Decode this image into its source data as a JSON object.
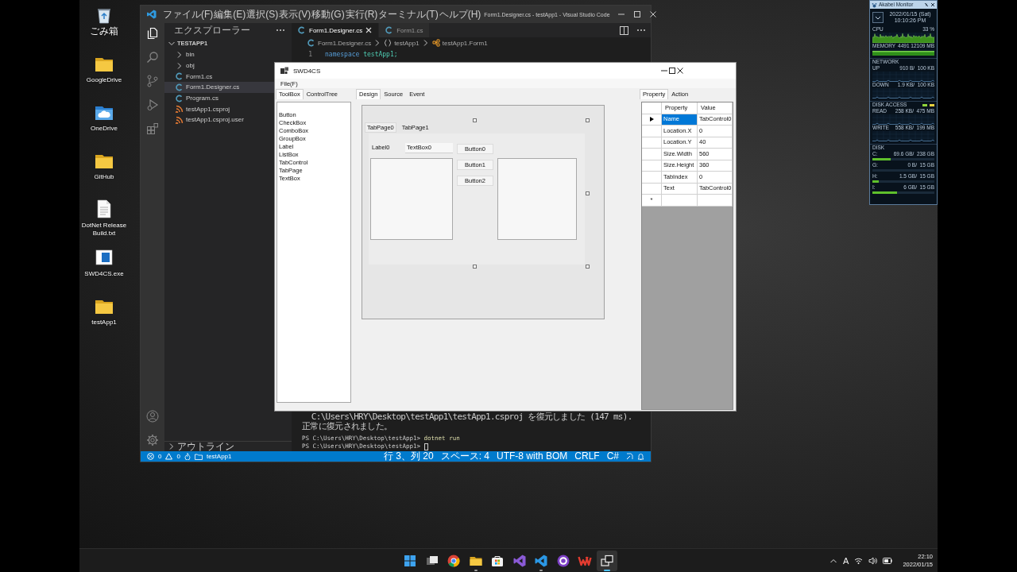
{
  "desktop_icons": [
    {
      "label": "ごみ箱",
      "kind": "recycle"
    },
    {
      "label": "GoogleDrive",
      "kind": "folder"
    },
    {
      "label": "OneDrive",
      "kind": "cloud"
    },
    {
      "label": "GitHub",
      "kind": "folder"
    },
    {
      "label": "DotNet Release Build.txt",
      "kind": "text"
    },
    {
      "label": "SWD4CS.exe",
      "kind": "app"
    },
    {
      "label": "testApp1",
      "kind": "folder"
    }
  ],
  "vscode": {
    "menu": [
      "ファイル(F)",
      "編集(E)",
      "選択(S)",
      "表示(V)",
      "移動(G)",
      "実行(R)",
      "ターミナル(T)",
      "ヘルプ(H)"
    ],
    "title": "Form1.Designer.cs - testApp1 - Visual Studio Code",
    "activity_bar": [
      {
        "kind": "explorer",
        "selected": true
      },
      {
        "kind": "search",
        "selected": false
      },
      {
        "kind": "source_control",
        "selected": false
      },
      {
        "kind": "run",
        "selected": false
      },
      {
        "kind": "extensions",
        "selected": false
      },
      {
        "kind": "account",
        "selected": false
      },
      {
        "kind": "settings",
        "selected": false
      }
    ],
    "explorer": {
      "title": "エクスプローラー",
      "project": "TESTAPP1",
      "items": [
        {
          "label": "bin",
          "kind": "folder",
          "expanded": false,
          "selected": false
        },
        {
          "label": "obj",
          "kind": "folder",
          "expanded": false,
          "selected": false
        },
        {
          "label": "Form1.cs",
          "kind": "csharp",
          "selected": false
        },
        {
          "label": "Form1.Designer.cs",
          "kind": "csharp",
          "selected": true
        },
        {
          "label": "Program.cs",
          "kind": "csharp",
          "selected": false
        },
        {
          "label": "testApp1.csproj",
          "kind": "project",
          "selected": false
        },
        {
          "label": "testApp1.csproj.user",
          "kind": "project",
          "selected": false
        }
      ],
      "outline": "アウトライン"
    },
    "tabs": [
      {
        "label": "Form1.Designer.cs",
        "selected": true
      },
      {
        "label": "Form1.cs",
        "selected": false
      }
    ],
    "breadcrumb": [
      {
        "label": "Form1.Designer.cs",
        "kind": "file"
      },
      {
        "label": "testApp1",
        "kind": "namespace"
      },
      {
        "label": "testApp1.Form1",
        "kind": "class"
      }
    ],
    "code_lines": [
      {
        "number": "1",
        "keyword": "namespace",
        "text": " testApp1;"
      }
    ],
    "terminal_lines": [
      {
        "kind": "output",
        "text": "  C:\\Users\\HRY\\Desktop\\testApp1\\testApp1.csproj を復元しました (147 ms)."
      },
      {
        "kind": "output",
        "text": "正常に復元されました。"
      },
      {
        "kind": "prompt",
        "prompt": "PS C:\\Users\\HRY\\Desktop\\testApp1> ",
        "command": "dotnet run"
      },
      {
        "kind": "prompt",
        "prompt": "PS C:\\Users\\HRY\\Desktop\\testApp1> ",
        "cursor": true
      }
    ],
    "status_bar": {
      "errors": "0",
      "warnings": "0",
      "folder": "testApp1",
      "items": [
        "行 3、列 20",
        "スペース: 4",
        "UTF-8 with BOM",
        "CRLF",
        "C#"
      ]
    }
  },
  "swd4cs": {
    "title": "SWD4CS",
    "menu": [
      "File(F)"
    ],
    "left_tabs": [
      {
        "label": "ToolBox",
        "selected": true
      },
      {
        "label": "ControlTree",
        "selected": false
      }
    ],
    "toolbox_items": [
      "Button",
      "CheckBox",
      "ComboBox",
      "GroupBox",
      "Label",
      "ListBox",
      "TabControl",
      "TabPage",
      "TextBox"
    ],
    "center_tabs": [
      {
        "label": "Design",
        "selected": true
      },
      {
        "label": "Source",
        "selected": false
      },
      {
        "label": "Event",
        "selected": false
      }
    ],
    "design": {
      "tab_pages": [
        {
          "label": "TabPage0",
          "selected": true
        },
        {
          "label": "TabPage1",
          "selected": false
        }
      ],
      "controls": [
        {
          "kind": "label",
          "text": "Label0"
        },
        {
          "kind": "textbox",
          "text": "TextBox0"
        },
        {
          "kind": "button",
          "text": "Button0"
        },
        {
          "kind": "button",
          "text": "Button1"
        },
        {
          "kind": "button",
          "text": "Button2"
        },
        {
          "kind": "listbox"
        },
        {
          "kind": "listbox"
        }
      ]
    },
    "right_tabs": [
      {
        "label": "Property",
        "selected": true
      },
      {
        "label": "Action",
        "selected": false
      }
    ],
    "property_grid": {
      "columns": [
        "Property",
        "Value"
      ],
      "rows": [
        {
          "property": "Name",
          "value": "TabControl0",
          "selected": true
        },
        {
          "property": "Location.X",
          "value": "0",
          "selected": false
        },
        {
          "property": "Location.Y",
          "value": "40",
          "selected": false
        },
        {
          "property": "Size.Width",
          "value": "560",
          "selected": false
        },
        {
          "property": "Size.Height",
          "value": "360",
          "selected": false
        },
        {
          "property": "TabIndex",
          "value": "0",
          "selected": false
        },
        {
          "property": "Text",
          "value": "TabControl0",
          "selected": false
        }
      ],
      "new_row_marker": "*"
    }
  },
  "monitor": {
    "title": "Akabei Monitor",
    "date": "2022/01/15 (Sat)",
    "time": "10:10:26 PM",
    "sections": [
      {
        "kind": "load_graph",
        "label": "CPU",
        "value": "33 %"
      },
      {
        "kind": "usage_graph",
        "label": "MEMORY",
        "value": "4491 12109 MB"
      },
      {
        "kind": "header",
        "label": "NETWORK"
      },
      {
        "kind": "graph",
        "label": "UP",
        "value": "910 B/  100 KB"
      },
      {
        "kind": "graph",
        "label": "DOWN",
        "value": "1.9 KB/  100 KB"
      },
      {
        "kind": "header_lights",
        "label": "DISK ACCESS"
      },
      {
        "kind": "graph",
        "label": "READ",
        "value": "258 KB/  475 MB"
      },
      {
        "kind": "graph",
        "label": "WRITE",
        "value": "558 KB/  199 MB"
      },
      {
        "kind": "header",
        "label": "DISK"
      },
      {
        "kind": "bar",
        "label": "C:",
        "value": "69.6 GB/  238 GB",
        "level": 0.29
      },
      {
        "kind": "bar",
        "label": "G:",
        "value": "0 B/  15 GB",
        "level": 0
      },
      {
        "kind": "bar",
        "label": "H:",
        "value": "1.5 GB/  15 GB",
        "level": 0.1
      },
      {
        "kind": "bar",
        "label": "I:",
        "value": "6 GB/  15 GB",
        "level": 0.4
      }
    ]
  },
  "taskbar": {
    "apps": [
      {
        "kind": "start",
        "running": false,
        "selected": false
      },
      {
        "kind": "taskview",
        "running": false,
        "selected": false
      },
      {
        "kind": "browser",
        "running": false,
        "selected": false
      },
      {
        "kind": "files",
        "running": true,
        "selected": false
      },
      {
        "kind": "store",
        "running": false,
        "selected": false
      },
      {
        "kind": "vs",
        "running": false,
        "selected": false
      },
      {
        "kind": "vscode",
        "running": true,
        "selected": false
      },
      {
        "kind": "ring",
        "running": false,
        "selected": false
      },
      {
        "kind": "office",
        "running": false,
        "selected": false
      },
      {
        "kind": "windows",
        "running": true,
        "selected": true
      }
    ],
    "ime": "A",
    "time": "22:10",
    "date": "2022/01/15"
  }
}
